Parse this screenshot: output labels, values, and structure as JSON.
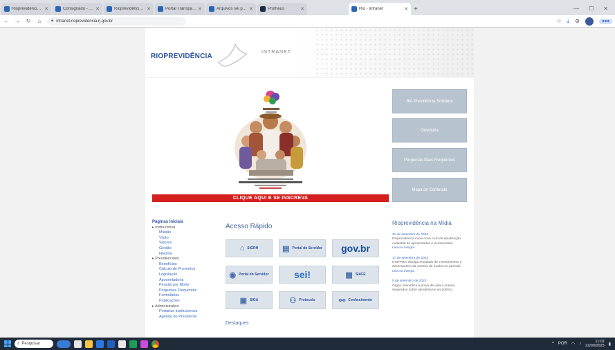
{
  "browser": {
    "tabs": [
      {
        "label": "Rioprevidência - Contra-ch..."
      },
      {
        "label": "Consignado - Acesso Rest..."
      },
      {
        "label": "Rioprevidência - Portal d..."
      },
      {
        "label": "Portal Transparência RJ..."
      },
      {
        "label": "Arquivos sei proveniente..."
      },
      {
        "label": "Protheus"
      },
      {
        "label": "Rio - Intranet",
        "active": true
      }
    ],
    "new_tab": "+",
    "url": "intranet.rioprevidencia.rj.gov.br"
  },
  "header": {
    "logo_text": "RIOPREVIDÊNCIA",
    "intranet_label": "INTRANET"
  },
  "banner": {
    "cta": "CLIQUE AQUI E SE INSCREVA"
  },
  "side_buttons": [
    {
      "label": "Rio Previdência Solidária"
    },
    {
      "label": "Ouvidoria"
    },
    {
      "label": "Perguntas Mais Frequentes"
    },
    {
      "label": "Mapa do Conteúdo"
    }
  ],
  "quick_links": {
    "title": "Páginas Iniciais",
    "sections": [
      {
        "group": "Institucional",
        "items": [
          "Missão",
          "Visão",
          "Valores",
          "Gestão",
          "História"
        ]
      },
      {
        "group": "Previdenciário",
        "items": [
          "Benefícios",
          "Cálculo de Proventos",
          "Legislação",
          "Aposentadoria",
          "Pensão por Morte",
          "Perguntas Frequentes",
          "Formulários",
          "Publicações"
        ]
      },
      {
        "group": "Administrativo",
        "items": [
          "Portarias Institucionais",
          "Agenda do Presidente"
        ]
      }
    ]
  },
  "acesso_rapido": {
    "title": "Acesso Rápido",
    "tiles": [
      {
        "label": "SIGRH",
        "icon": "building-icon"
      },
      {
        "label": "Portal do Servidor",
        "icon": "doc-icon"
      },
      {
        "label": "gov.br",
        "icon": ""
      },
      {
        "label": "Portal do Servidor",
        "icon": "portal-icon"
      },
      {
        "label": "sei!",
        "icon": ""
      },
      {
        "label": "SIAFE",
        "icon": "grid-icon"
      },
      {
        "label": "SIGA",
        "icon": "cash-icon"
      },
      {
        "label": "Protocolo",
        "icon": "people-icon"
      },
      {
        "label": "Conhecimento",
        "icon": "network-icon"
      }
    ],
    "destaques_title": "Destaques"
  },
  "news": {
    "title": "Rioprevidência na Mídia",
    "items": [
      {
        "date": "21 de setembro de 2023",
        "text": "Rioprevidência inicia novo ciclo de atualização cadastral de aposentados e pensionistas.",
        "more": "Leia na íntegra"
      },
      {
        "date": "17 de setembro de 2023",
        "text": "RIOPREV divulga resultado de investimentos e desempenho da carteira de fundos no período.",
        "more": "Leia na íntegra"
      },
      {
        "date": "5 de setembro de 2023",
        "text": "Órgão intensifica a prova de vida e orienta segurados sobre atendimento ao público.",
        "more": ""
      }
    ]
  },
  "taskbar": {
    "search_placeholder": "Pesquisar",
    "time": "11:02",
    "date": "22/09/2023",
    "lang": "POR"
  }
}
